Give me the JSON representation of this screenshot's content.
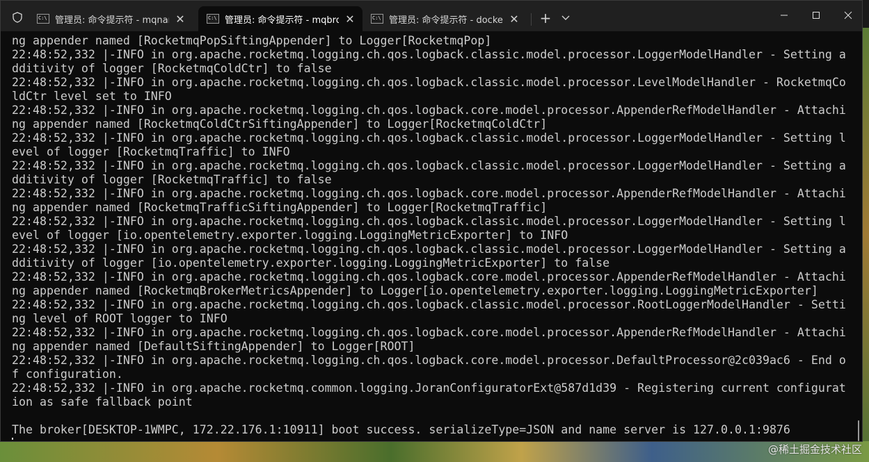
{
  "tabs": [
    {
      "label": "管理员: 命令提示符 - mqnamesrv",
      "close": "✕",
      "active": false
    },
    {
      "label": "管理员: 命令提示符 - mqbroker",
      "close": "✕",
      "active": true
    },
    {
      "label": "管理员: 命令提示符 - docker run",
      "close": "✕",
      "active": false
    }
  ],
  "toolbar": {
    "new_tab": "+",
    "dropdown_icon": "chevron-down-icon"
  },
  "window_controls": {
    "minimize": "—",
    "maximize": "☐",
    "close": "✕"
  },
  "terminal": {
    "lines": [
      "ng appender named [RocketmqPopSiftingAppender] to Logger[RocketmqPop]",
      "22:48:52,332 |-INFO in org.apache.rocketmq.logging.ch.qos.logback.classic.model.processor.LoggerModelHandler - Setting a",
      "dditivity of logger [RocketmqColdCtr] to false",
      "22:48:52,332 |-INFO in org.apache.rocketmq.logging.ch.qos.logback.classic.model.processor.LevelModelHandler - RocketmqCo",
      "ldCtr level set to INFO",
      "22:48:52,332 |-INFO in org.apache.rocketmq.logging.ch.qos.logback.core.model.processor.AppenderRefModelHandler - Attachi",
      "ng appender named [RocketmqColdCtrSiftingAppender] to Logger[RocketmqColdCtr]",
      "22:48:52,332 |-INFO in org.apache.rocketmq.logging.ch.qos.logback.classic.model.processor.LoggerModelHandler - Setting l",
      "evel of logger [RocketmqTraffic] to INFO",
      "22:48:52,332 |-INFO in org.apache.rocketmq.logging.ch.qos.logback.classic.model.processor.LoggerModelHandler - Setting a",
      "dditivity of logger [RocketmqTraffic] to false",
      "22:48:52,332 |-INFO in org.apache.rocketmq.logging.ch.qos.logback.core.model.processor.AppenderRefModelHandler - Attachi",
      "ng appender named [RocketmqTrafficSiftingAppender] to Logger[RocketmqTraffic]",
      "22:48:52,332 |-INFO in org.apache.rocketmq.logging.ch.qos.logback.classic.model.processor.LoggerModelHandler - Setting l",
      "evel of logger [io.opentelemetry.exporter.logging.LoggingMetricExporter] to INFO",
      "22:48:52,332 |-INFO in org.apache.rocketmq.logging.ch.qos.logback.classic.model.processor.LoggerModelHandler - Setting a",
      "dditivity of logger [io.opentelemetry.exporter.logging.LoggingMetricExporter] to false",
      "22:48:52,332 |-INFO in org.apache.rocketmq.logging.ch.qos.logback.core.model.processor.AppenderRefModelHandler - Attachi",
      "ng appender named [RocketmqBrokerMetricsAppender] to Logger[io.opentelemetry.exporter.logging.LoggingMetricExporter]",
      "22:48:52,332 |-INFO in org.apache.rocketmq.logging.ch.qos.logback.classic.model.processor.RootLoggerModelHandler - Setti",
      "ng level of ROOT logger to INFO",
      "22:48:52,332 |-INFO in org.apache.rocketmq.logging.ch.qos.logback.core.model.processor.AppenderRefModelHandler - Attachi",
      "ng appender named [DefaultSiftingAppender] to Logger[ROOT]",
      "22:48:52,332 |-INFO in org.apache.rocketmq.logging.ch.qos.logback.core.model.processor.DefaultProcessor@2c039ac6 - End o",
      "f configuration.",
      "22:48:52,332 |-INFO in org.apache.rocketmq.common.logging.JoranConfiguratorExt@587d1d39 - Registering current configurat",
      "ion as safe fallback point",
      "",
      "The broker[DESKTOP-1WMPC, 172.22.176.1:10911] boot success. serializeType=JSON and name server is 127.0.0.1:9876"
    ]
  },
  "watermark": "@稀土掘金技术社区",
  "colors": {
    "terminal_bg": "#0c0c0c",
    "terminal_fg": "#cccccc",
    "titlebar_bg": "#202020"
  }
}
